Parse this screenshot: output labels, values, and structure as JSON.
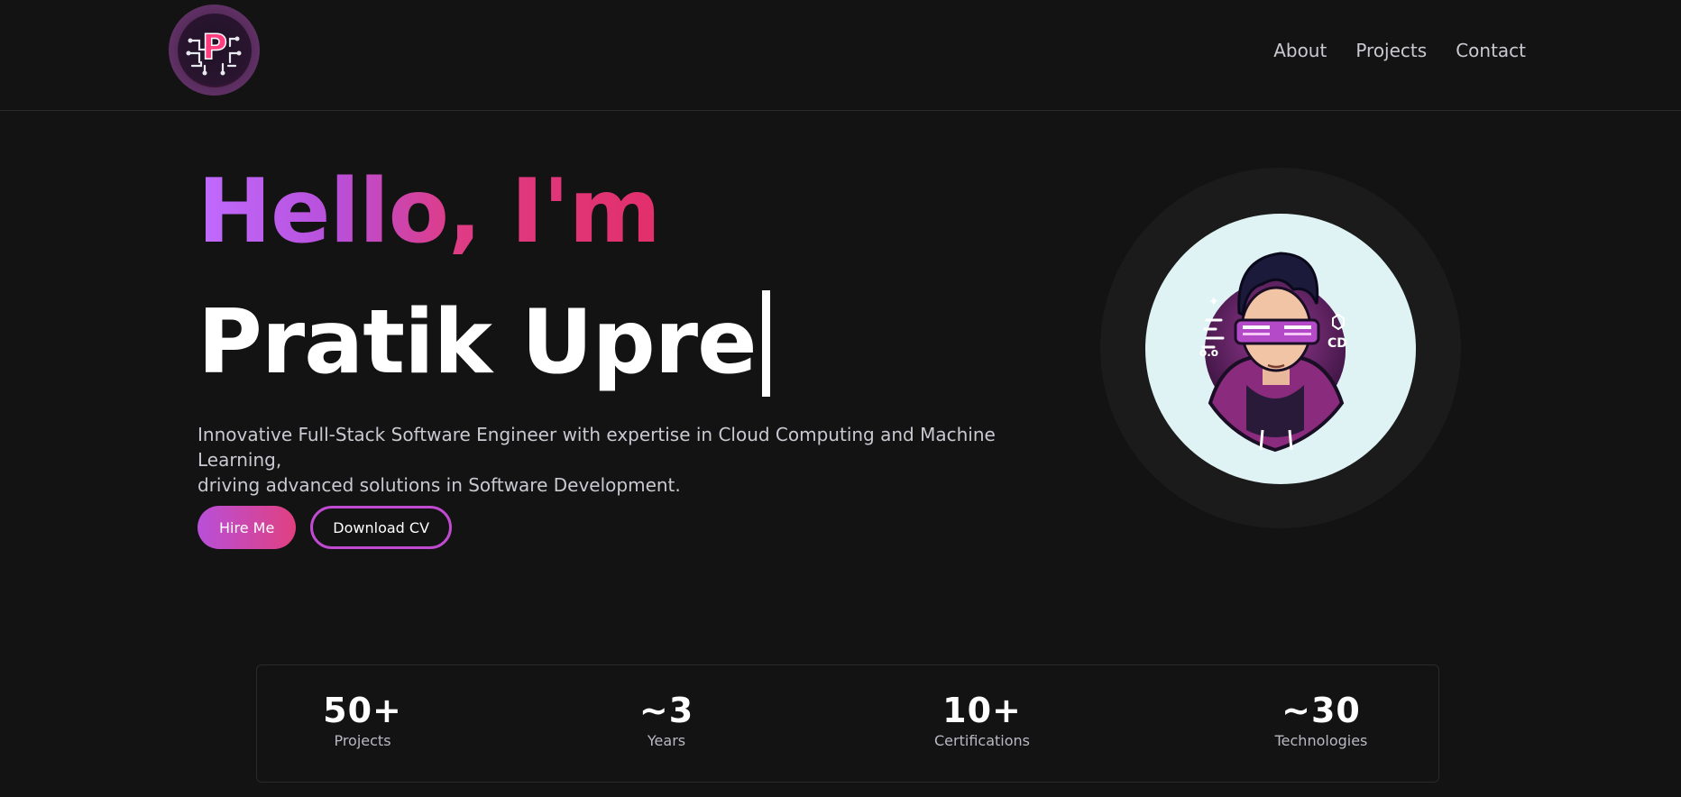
{
  "header": {
    "logo_letter": "P",
    "nav": [
      {
        "label": "About"
      },
      {
        "label": "Projects"
      },
      {
        "label": "Contact"
      }
    ]
  },
  "hero": {
    "greeting": "Hello, I'm",
    "name": "Pratik Upre",
    "tagline_line1": "Innovative Full-Stack Software Engineer with expertise in Cloud Computing and Machine Learning,",
    "tagline_line2": "driving advanced solutions in Software Development.",
    "primary_button": "Hire Me",
    "secondary_button": "Download CV"
  },
  "avatar": {
    "badge_text": "CD"
  },
  "stats": [
    {
      "value": "50+",
      "label": "Projects"
    },
    {
      "value": "~3",
      "label": "Years"
    },
    {
      "value": "10+",
      "label": "Certifications"
    },
    {
      "value": "~30",
      "label": "Technologies"
    }
  ],
  "colors": {
    "background": "#131313",
    "accent_purple": "#b84fd9",
    "accent_pink": "#e04080",
    "text_muted": "#c9c9d1"
  }
}
